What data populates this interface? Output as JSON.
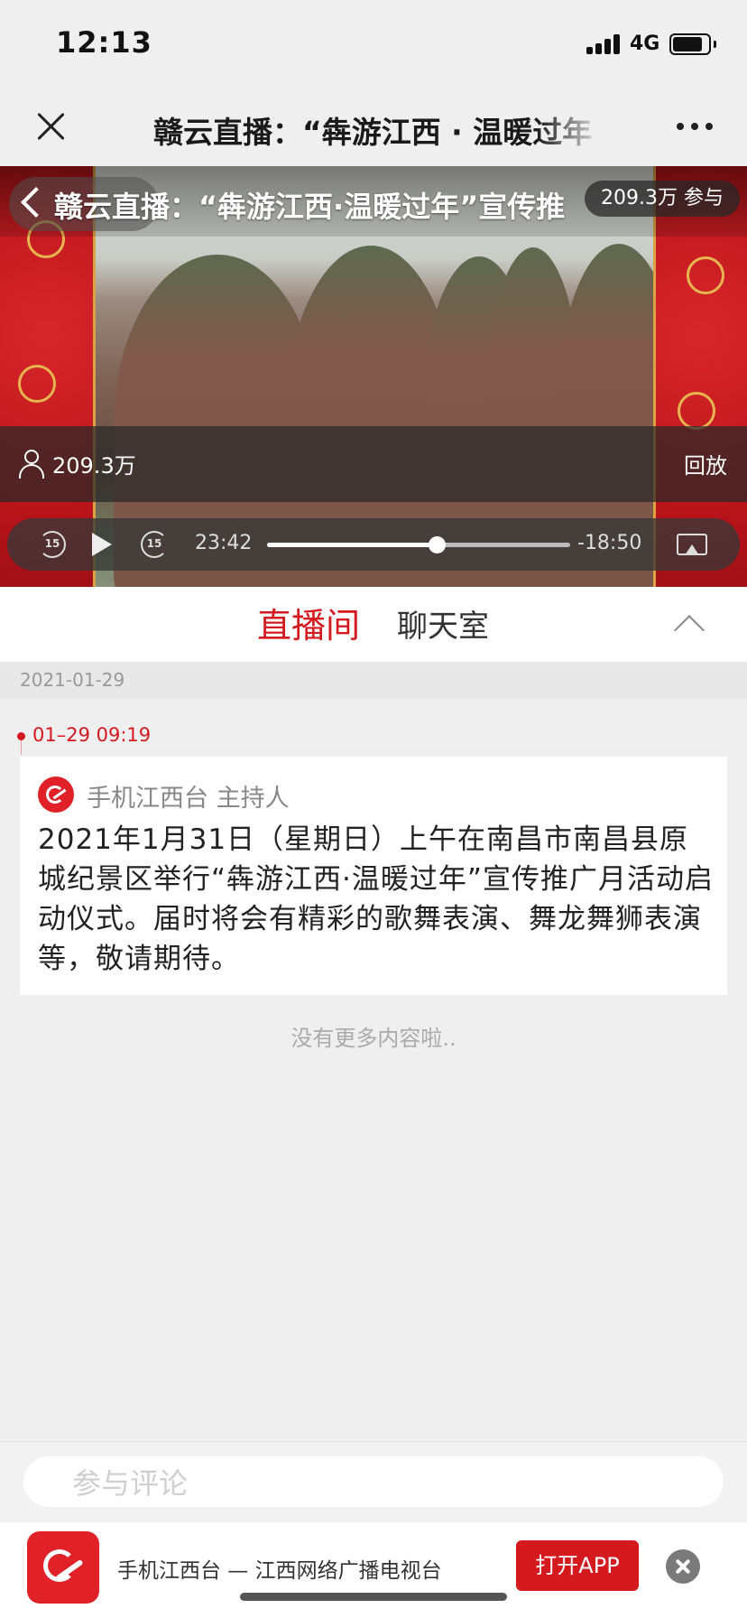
{
  "status_bar": {
    "time": "12:13",
    "network": "4G"
  },
  "nav": {
    "title": "赣云直播：“犇游江西 · 温暖过年"
  },
  "video": {
    "title": "赣云直播：“犇游江西·温暖过年”宣传推",
    "participants": "209.3万 参与",
    "viewer_count": "209.3万",
    "replay_label": "回放",
    "skip_back_label": "15",
    "skip_forward_label": "15",
    "time_current": "23:42",
    "time_remaining": "-18:50",
    "progress_fraction": 0.56
  },
  "tabs": {
    "live_room": "直播间",
    "chat_room": "聊天室"
  },
  "feed": {
    "date": "2021-01-29",
    "post": {
      "time": "01–29 09:19",
      "author": "手机江西台 主持人",
      "content": "2021年1月31日（星期日）上午在南昌市南昌县原城纪景区举行“犇游江西·温暖过年”宣传推广月活动启动仪式。届时将会有精彩的歌舞表演、舞龙舞狮表演等，敬请期待。"
    },
    "no_more": "没有更多内容啦.."
  },
  "comment": {
    "placeholder": "参与评论"
  },
  "app_banner": {
    "name": "手机江西台 — 江西网络广播电视台",
    "open_button": "打开APP"
  },
  "colors": {
    "accent": "#d4191f",
    "background": "#f0eff0"
  }
}
